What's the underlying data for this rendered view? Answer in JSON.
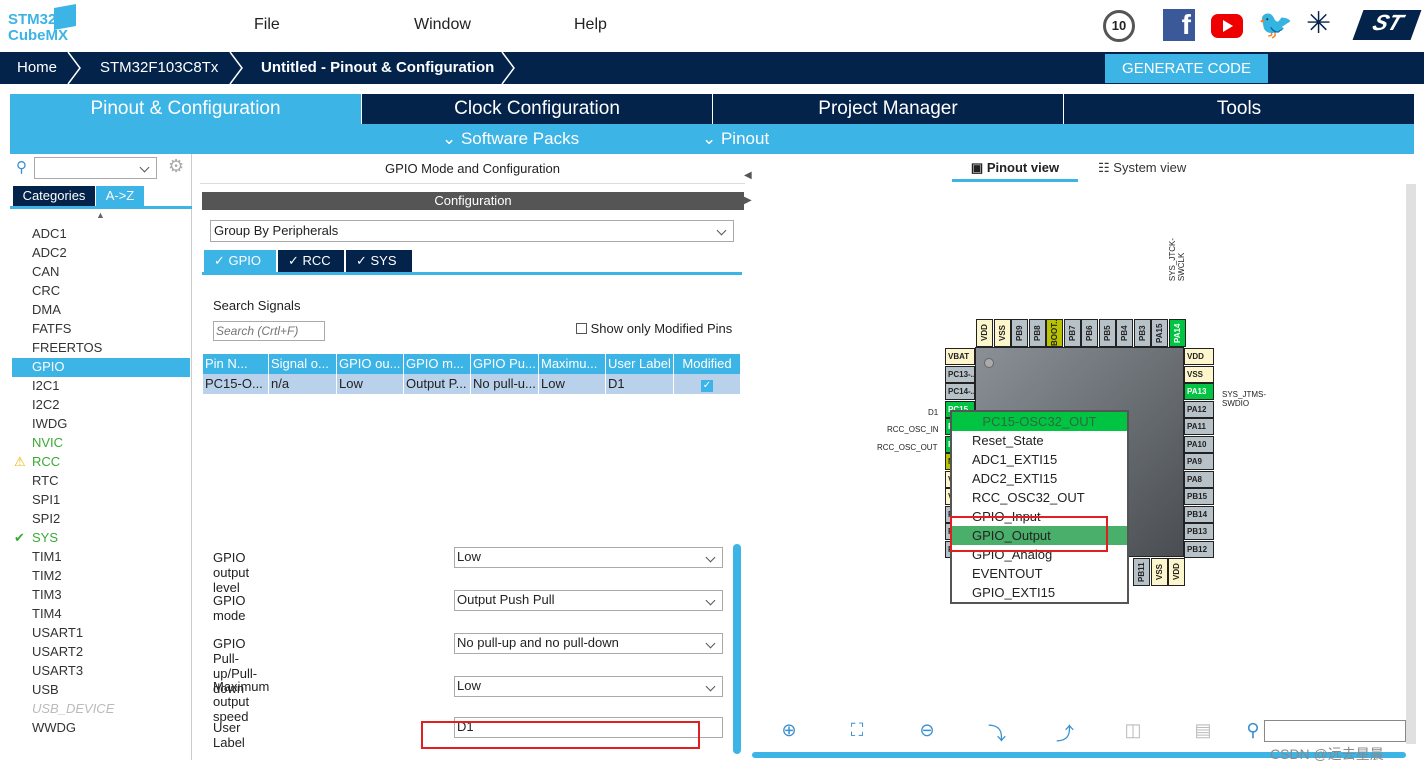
{
  "app": {
    "logo": "STM32 CubeMX",
    "menu": [
      "File",
      "Window",
      "Help"
    ],
    "social_icons": [
      "anniversary-badge-icon",
      "facebook-icon",
      "youtube-icon",
      "twitter-icon",
      "network-icon",
      "st-logo-icon"
    ]
  },
  "breadcrumb": [
    "Home",
    "STM32F103C8Tx",
    "Untitled - Pinout & Configuration"
  ],
  "generate_label": "GENERATE CODE",
  "tabs": [
    "Pinout & Configuration",
    "Clock Configuration",
    "Project Manager",
    "Tools"
  ],
  "subtabs": [
    "Software Packs",
    "Pinout"
  ],
  "left": {
    "search_placeholder": "",
    "tabs": [
      "Categories",
      "A->Z"
    ],
    "items": [
      {
        "label": "ADC1",
        "s": ""
      },
      {
        "label": "ADC2",
        "s": ""
      },
      {
        "label": "CAN",
        "s": ""
      },
      {
        "label": "CRC",
        "s": ""
      },
      {
        "label": "DMA",
        "s": ""
      },
      {
        "label": "FATFS",
        "s": ""
      },
      {
        "label": "FREERTOS",
        "s": ""
      },
      {
        "label": "GPIO",
        "s": "selected"
      },
      {
        "label": "I2C1",
        "s": ""
      },
      {
        "label": "I2C2",
        "s": ""
      },
      {
        "label": "IWDG",
        "s": ""
      },
      {
        "label": "NVIC",
        "s": "green"
      },
      {
        "label": "RCC",
        "s": "warn"
      },
      {
        "label": "RTC",
        "s": ""
      },
      {
        "label": "SPI1",
        "s": ""
      },
      {
        "label": "SPI2",
        "s": ""
      },
      {
        "label": "SYS",
        "s": "check"
      },
      {
        "label": "TIM1",
        "s": ""
      },
      {
        "label": "TIM2",
        "s": ""
      },
      {
        "label": "TIM3",
        "s": ""
      },
      {
        "label": "TIM4",
        "s": ""
      },
      {
        "label": "USART1",
        "s": ""
      },
      {
        "label": "USART2",
        "s": ""
      },
      {
        "label": "USART3",
        "s": ""
      },
      {
        "label": "USB",
        "s": ""
      },
      {
        "label": "USB_DEVICE",
        "s": "disabled"
      },
      {
        "label": "WWDG",
        "s": ""
      }
    ]
  },
  "mid": {
    "title": "GPIO Mode and Configuration",
    "config": "Configuration",
    "group_by": "Group By Peripherals",
    "ptabs": [
      "GPIO",
      "RCC",
      "SYS"
    ],
    "search_label": "Search Signals",
    "search_placeholder": "Search (Crtl+F)",
    "show_modified": "Show only Modified Pins",
    "columns": [
      "Pin N...",
      "Signal o...",
      "GPIO ou...",
      "GPIO m...",
      "GPIO Pu...",
      "Maximu...",
      "User Label",
      "Modified"
    ],
    "row": [
      "PC15-O...",
      "n/a",
      "Low",
      "Output P...",
      "No pull-u...",
      "Low",
      "D1"
    ],
    "row_modified": true,
    "props": [
      {
        "label": "GPIO output level",
        "value": "Low"
      },
      {
        "label": "GPIO mode",
        "value": "Output Push Pull"
      },
      {
        "label": "GPIO Pull-up/Pull-down",
        "value": "No pull-up and no pull-down"
      },
      {
        "label": "Maximum output speed",
        "value": "Low"
      },
      {
        "label": "User Label",
        "value": "D1"
      }
    ]
  },
  "right": {
    "views": [
      "Pinout view",
      "System view"
    ],
    "top_pins": [
      [
        "VDD",
        "y"
      ],
      [
        "VSS",
        "y"
      ],
      [
        "PB9",
        "g"
      ],
      [
        "PB8",
        "g"
      ],
      [
        "BOOT..",
        "ol"
      ],
      [
        "PB7",
        "g"
      ],
      [
        "PB6",
        "g"
      ],
      [
        "PB5",
        "g"
      ],
      [
        "PB4",
        "g"
      ],
      [
        "PB3",
        "g"
      ],
      [
        "PA15",
        "g"
      ],
      [
        "PA14",
        "gr"
      ]
    ],
    "left_pins": [
      [
        "VBAT",
        "y"
      ],
      [
        "PC13-..",
        "g"
      ],
      [
        "PC14-..",
        "g"
      ],
      [
        "PC15",
        "gr"
      ],
      [
        "PD0",
        "gr"
      ],
      [
        "PD1",
        "gr"
      ],
      [
        "N",
        "ol"
      ],
      [
        "V",
        "y"
      ],
      [
        "V",
        "y"
      ],
      [
        "P",
        "g"
      ],
      [
        "P",
        "g"
      ],
      [
        "P",
        "g"
      ]
    ],
    "right_pins": [
      [
        "VDD",
        "y"
      ],
      [
        "VSS",
        "y"
      ],
      [
        "PA13",
        "gr"
      ],
      [
        "PA12",
        "g"
      ],
      [
        "PA11",
        "g"
      ],
      [
        "PA10",
        "g"
      ],
      [
        "PA9",
        "g"
      ],
      [
        "PA8",
        "g"
      ],
      [
        "PB15",
        "g"
      ],
      [
        "PB14",
        "g"
      ],
      [
        "PB13",
        "g"
      ],
      [
        "PB12",
        "g"
      ]
    ],
    "bottom_pins": [
      [
        "PB11",
        "g"
      ],
      [
        "VSS",
        "y"
      ],
      [
        "VDD",
        "y"
      ]
    ],
    "labels": {
      "pa14": "SYS_JTCK-SWCLK",
      "pa13": "SYS_JTMS-SWDIO",
      "pc15": "D1",
      "pd0": "RCC_OSC_IN",
      "pd1": "RCC_OSC_OUT"
    },
    "popup": {
      "title": "PC15-OSC32_OUT",
      "items": [
        "Reset_State",
        "ADC1_EXTI15",
        "ADC2_EXTI15",
        "RCC_OSC32_OUT",
        "GPIO_Input",
        "GPIO_Output",
        "GPIO_Analog",
        "EVENTOUT",
        "GPIO_EXTI15"
      ],
      "selected": "GPIO_Output"
    },
    "toolbar": [
      "zoom-in-icon",
      "fit-icon",
      "zoom-out-icon",
      "rotate-right-icon",
      "rotate-left-icon",
      "split-vertical-icon",
      "split-horizontal-icon",
      "search-icon"
    ]
  },
  "watermark": "CSDN @远去星晨",
  "colors": {
    "navy": "#03234b",
    "accent": "#3cb4e6",
    "pin_green": "#00c442",
    "highlight_red": "#e02020"
  }
}
